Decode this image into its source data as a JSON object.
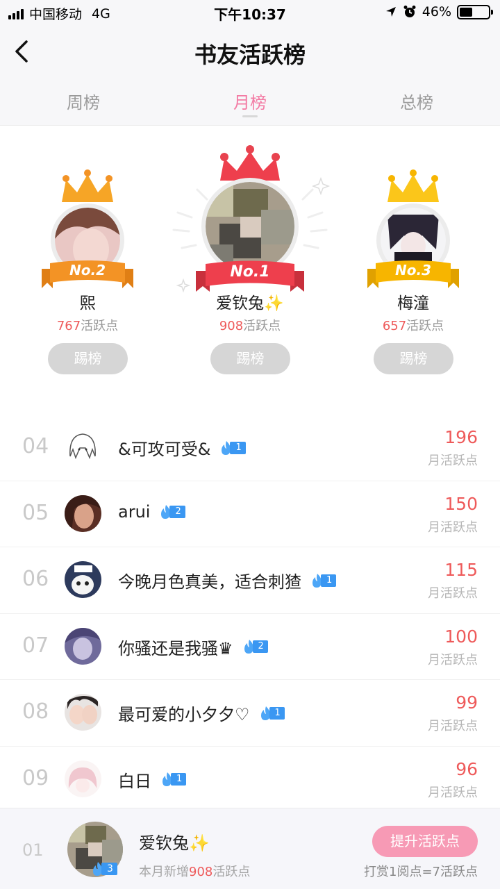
{
  "status_bar": {
    "carrier": "中国移动",
    "network": "4G",
    "time": "下午10:37",
    "battery": "46%",
    "battery_level": 0.46
  },
  "nav": {
    "title": "书友活跃榜",
    "back_icon": "chevron-left-icon"
  },
  "tabs": [
    {
      "label": "周榜",
      "active": false
    },
    {
      "label": "月榜",
      "active": true
    },
    {
      "label": "总榜",
      "active": false
    }
  ],
  "podium": {
    "kick_label": "踢榜",
    "points_suffix": "活跃点",
    "first": {
      "rank_label": "No.1",
      "name": "爱钦兔✨",
      "points": "908"
    },
    "second": {
      "rank_label": "No.2",
      "name": "熙",
      "points": "767"
    },
    "third": {
      "rank_label": "No.3",
      "name": "梅潼",
      "points": "657"
    }
  },
  "list": {
    "score_label": "月活跃点",
    "rows": [
      {
        "rank": "04",
        "name": "&可攻可受&",
        "level": "1",
        "score": "196"
      },
      {
        "rank": "05",
        "name": "arui",
        "level": "2",
        "score": "150"
      },
      {
        "rank": "06",
        "name": "今晚月色真美，适合刺猹",
        "level": "1",
        "score": "115"
      },
      {
        "rank": "07",
        "name": "你骚还是我骚♛",
        "level": "2",
        "score": "100"
      },
      {
        "rank": "08",
        "name": "最可爱的小夕夕♡",
        "level": "1",
        "score": "99"
      },
      {
        "rank": "09",
        "name": "白日",
        "level": "1",
        "score": "96"
      }
    ]
  },
  "my_rank": {
    "rank": "01",
    "name": "爱钦兔✨",
    "level": "3",
    "desc_prefix": "本月新增",
    "desc_value": "908",
    "desc_suffix": "活跃点",
    "boost_label": "提升活跃点",
    "hint": "打赏1阅点=7活跃点"
  },
  "colors": {
    "accent_pink": "#f37ba4",
    "score_red": "#ee5a5a",
    "badge_blue": "#3a97f2",
    "gold": "#f7b500",
    "orange": "#f39325",
    "red": "#e8434f"
  }
}
